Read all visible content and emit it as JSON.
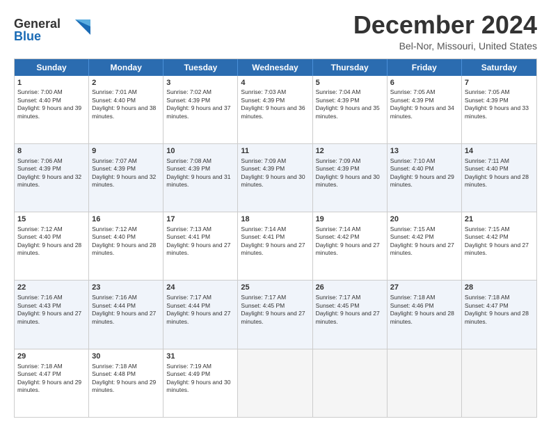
{
  "logo": {
    "line1": "General",
    "line2": "Blue"
  },
  "title": "December 2024",
  "subtitle": "Bel-Nor, Missouri, United States",
  "days": [
    "Sunday",
    "Monday",
    "Tuesday",
    "Wednesday",
    "Thursday",
    "Friday",
    "Saturday"
  ],
  "weeks": [
    [
      {
        "day": "1",
        "sunrise": "7:00 AM",
        "sunset": "4:40 PM",
        "daylight": "9 hours and 39 minutes."
      },
      {
        "day": "2",
        "sunrise": "7:01 AM",
        "sunset": "4:40 PM",
        "daylight": "9 hours and 38 minutes."
      },
      {
        "day": "3",
        "sunrise": "7:02 AM",
        "sunset": "4:39 PM",
        "daylight": "9 hours and 37 minutes."
      },
      {
        "day": "4",
        "sunrise": "7:03 AM",
        "sunset": "4:39 PM",
        "daylight": "9 hours and 36 minutes."
      },
      {
        "day": "5",
        "sunrise": "7:04 AM",
        "sunset": "4:39 PM",
        "daylight": "9 hours and 35 minutes."
      },
      {
        "day": "6",
        "sunrise": "7:05 AM",
        "sunset": "4:39 PM",
        "daylight": "9 hours and 34 minutes."
      },
      {
        "day": "7",
        "sunrise": "7:05 AM",
        "sunset": "4:39 PM",
        "daylight": "9 hours and 33 minutes."
      }
    ],
    [
      {
        "day": "8",
        "sunrise": "7:06 AM",
        "sunset": "4:39 PM",
        "daylight": "9 hours and 32 minutes."
      },
      {
        "day": "9",
        "sunrise": "7:07 AM",
        "sunset": "4:39 PM",
        "daylight": "9 hours and 32 minutes."
      },
      {
        "day": "10",
        "sunrise": "7:08 AM",
        "sunset": "4:39 PM",
        "daylight": "9 hours and 31 minutes."
      },
      {
        "day": "11",
        "sunrise": "7:09 AM",
        "sunset": "4:39 PM",
        "daylight": "9 hours and 30 minutes."
      },
      {
        "day": "12",
        "sunrise": "7:09 AM",
        "sunset": "4:39 PM",
        "daylight": "9 hours and 30 minutes."
      },
      {
        "day": "13",
        "sunrise": "7:10 AM",
        "sunset": "4:40 PM",
        "daylight": "9 hours and 29 minutes."
      },
      {
        "day": "14",
        "sunrise": "7:11 AM",
        "sunset": "4:40 PM",
        "daylight": "9 hours and 28 minutes."
      }
    ],
    [
      {
        "day": "15",
        "sunrise": "7:12 AM",
        "sunset": "4:40 PM",
        "daylight": "9 hours and 28 minutes."
      },
      {
        "day": "16",
        "sunrise": "7:12 AM",
        "sunset": "4:40 PM",
        "daylight": "9 hours and 28 minutes."
      },
      {
        "day": "17",
        "sunrise": "7:13 AM",
        "sunset": "4:41 PM",
        "daylight": "9 hours and 27 minutes."
      },
      {
        "day": "18",
        "sunrise": "7:14 AM",
        "sunset": "4:41 PM",
        "daylight": "9 hours and 27 minutes."
      },
      {
        "day": "19",
        "sunrise": "7:14 AM",
        "sunset": "4:42 PM",
        "daylight": "9 hours and 27 minutes."
      },
      {
        "day": "20",
        "sunrise": "7:15 AM",
        "sunset": "4:42 PM",
        "daylight": "9 hours and 27 minutes."
      },
      {
        "day": "21",
        "sunrise": "7:15 AM",
        "sunset": "4:42 PM",
        "daylight": "9 hours and 27 minutes."
      }
    ],
    [
      {
        "day": "22",
        "sunrise": "7:16 AM",
        "sunset": "4:43 PM",
        "daylight": "9 hours and 27 minutes."
      },
      {
        "day": "23",
        "sunrise": "7:16 AM",
        "sunset": "4:44 PM",
        "daylight": "9 hours and 27 minutes."
      },
      {
        "day": "24",
        "sunrise": "7:17 AM",
        "sunset": "4:44 PM",
        "daylight": "9 hours and 27 minutes."
      },
      {
        "day": "25",
        "sunrise": "7:17 AM",
        "sunset": "4:45 PM",
        "daylight": "9 hours and 27 minutes."
      },
      {
        "day": "26",
        "sunrise": "7:17 AM",
        "sunset": "4:45 PM",
        "daylight": "9 hours and 27 minutes."
      },
      {
        "day": "27",
        "sunrise": "7:18 AM",
        "sunset": "4:46 PM",
        "daylight": "9 hours and 28 minutes."
      },
      {
        "day": "28",
        "sunrise": "7:18 AM",
        "sunset": "4:47 PM",
        "daylight": "9 hours and 28 minutes."
      }
    ],
    [
      {
        "day": "29",
        "sunrise": "7:18 AM",
        "sunset": "4:47 PM",
        "daylight": "9 hours and 29 minutes."
      },
      {
        "day": "30",
        "sunrise": "7:18 AM",
        "sunset": "4:48 PM",
        "daylight": "9 hours and 29 minutes."
      },
      {
        "day": "31",
        "sunrise": "7:19 AM",
        "sunset": "4:49 PM",
        "daylight": "9 hours and 30 minutes."
      },
      null,
      null,
      null,
      null
    ]
  ]
}
